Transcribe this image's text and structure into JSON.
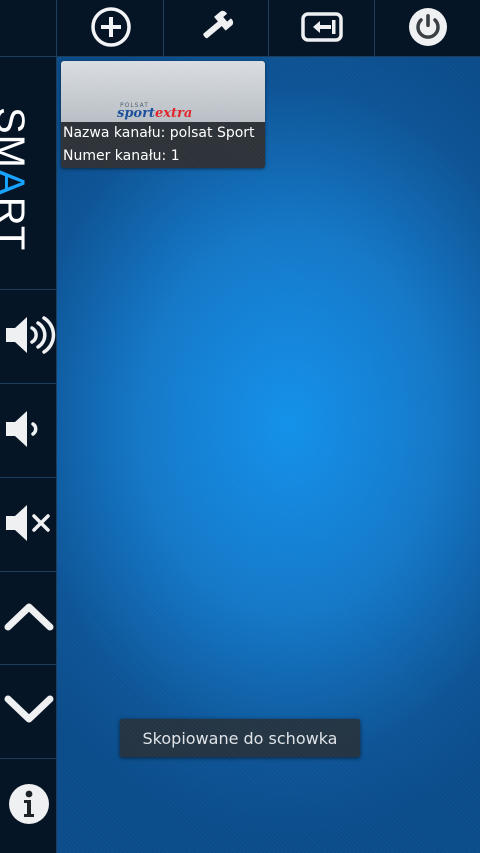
{
  "toolbar": {
    "buttons": [
      {
        "name": "add",
        "icon": "add-circle-icon"
      },
      {
        "name": "settings",
        "icon": "wrench-icon"
      },
      {
        "name": "input-source",
        "icon": "input-source-icon"
      },
      {
        "name": "power",
        "icon": "power-icon"
      }
    ]
  },
  "logo": {
    "text_before": "SM",
    "text_accent": "A",
    "text_after": "RT",
    "accent_color": "#17a3ff"
  },
  "sidebar": {
    "buttons": [
      {
        "name": "volume-up",
        "icon": "volume-up-icon"
      },
      {
        "name": "volume-down",
        "icon": "volume-down-icon"
      },
      {
        "name": "mute",
        "icon": "mute-icon"
      },
      {
        "name": "channel-up",
        "icon": "chevron-up-icon"
      },
      {
        "name": "channel-down",
        "icon": "chevron-down-icon"
      },
      {
        "name": "info",
        "icon": "info-icon"
      }
    ]
  },
  "channel_card": {
    "thumbnail": {
      "brand_small": "POLSAT",
      "brand_sport": "sport",
      "brand_extra": "extra"
    },
    "name_line": "Nazwa kanału: polsat Sport",
    "number_line": "Numer kanału: 1"
  },
  "toast": {
    "text": "Skopiowane do schowka"
  },
  "colors": {
    "background": "#041526",
    "main_blue": "#1391ea",
    "divider": "#1d3d5c"
  }
}
